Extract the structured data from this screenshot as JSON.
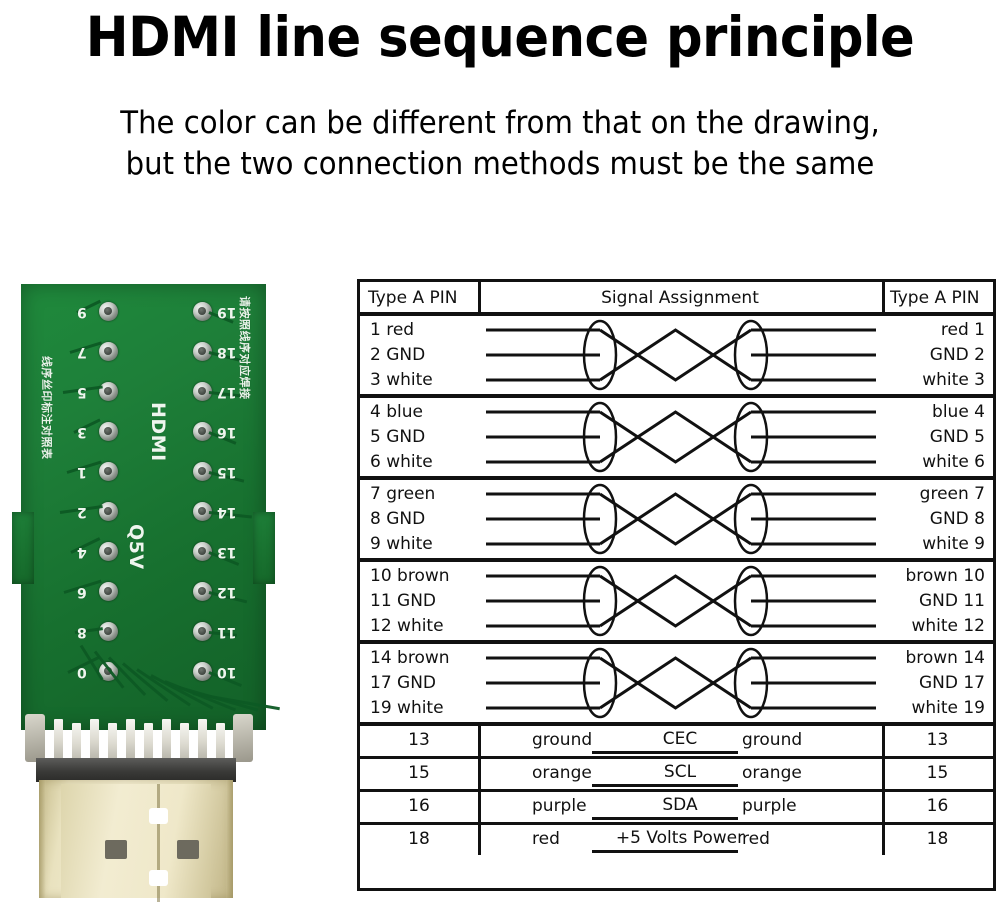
{
  "header": {
    "title": "HDMI line sequence principle",
    "subtitle_line1": "The color can be different from that on the drawing,",
    "subtitle_line2": "but the two connection methods must be the same"
  },
  "pcb": {
    "board_color": "#1e7f39",
    "connector_color": "#efe8c9",
    "band_color": "#3a3a38",
    "silk_center_top": "HDMI",
    "silk_center_bottom": "Q5V",
    "left_pin_numbers": [
      "1",
      "3",
      "5",
      "7",
      "9",
      "2",
      "4",
      "6",
      "8",
      "10"
    ],
    "left_pin_numbers_display": [
      "9",
      "7",
      "5",
      "3",
      "1",
      "2",
      "4",
      "6",
      "8",
      "0"
    ],
    "right_pin_numbers_display": [
      "19",
      "18",
      "17",
      "16",
      "15",
      "14",
      "13",
      "12",
      "11",
      "10"
    ],
    "silk_text_left": "线序丝印标注对照表",
    "silk_text_right": "请按照线序对应焊接",
    "pad_count_per_column": 10
  },
  "table": {
    "header": {
      "left": "Type A PIN",
      "center": "Signal Assignment",
      "right": "Type A PIN"
    },
    "twisted_groups": [
      {
        "left": [
          "1 red",
          "2 GND",
          "3 white"
        ],
        "right": [
          "red 1",
          "GND 2",
          "white 3"
        ]
      },
      {
        "left": [
          "4 blue",
          "5 GND",
          "6 white"
        ],
        "right": [
          "blue 4",
          "GND 5",
          "white 6"
        ]
      },
      {
        "left": [
          "7 green",
          "8 GND",
          "9 white"
        ],
        "right": [
          "green 7",
          "GND 8",
          "white 9"
        ]
      },
      {
        "left": [
          "10 brown",
          "11 GND",
          "12 white"
        ],
        "right": [
          "brown 10",
          "GND 11",
          "white 12"
        ]
      },
      {
        "left": [
          "14 brown",
          "17 GND",
          "19 white"
        ],
        "right": [
          "brown 14",
          "GND 17",
          "white 19"
        ]
      }
    ],
    "single_rows": [
      {
        "pin_left": "13",
        "color_left": "ground",
        "signal": "CEC",
        "color_right": "ground",
        "pin_right": "13"
      },
      {
        "pin_left": "15",
        "color_left": "orange",
        "signal": "SCL",
        "color_right": "orange",
        "pin_right": "15"
      },
      {
        "pin_left": "16",
        "color_left": "purple",
        "signal": "SDA",
        "color_right": "purple",
        "pin_right": "16"
      },
      {
        "pin_left": "18",
        "color_left": "red",
        "signal": "+5 Volts Power",
        "color_right": "red",
        "pin_right": "18"
      }
    ]
  }
}
